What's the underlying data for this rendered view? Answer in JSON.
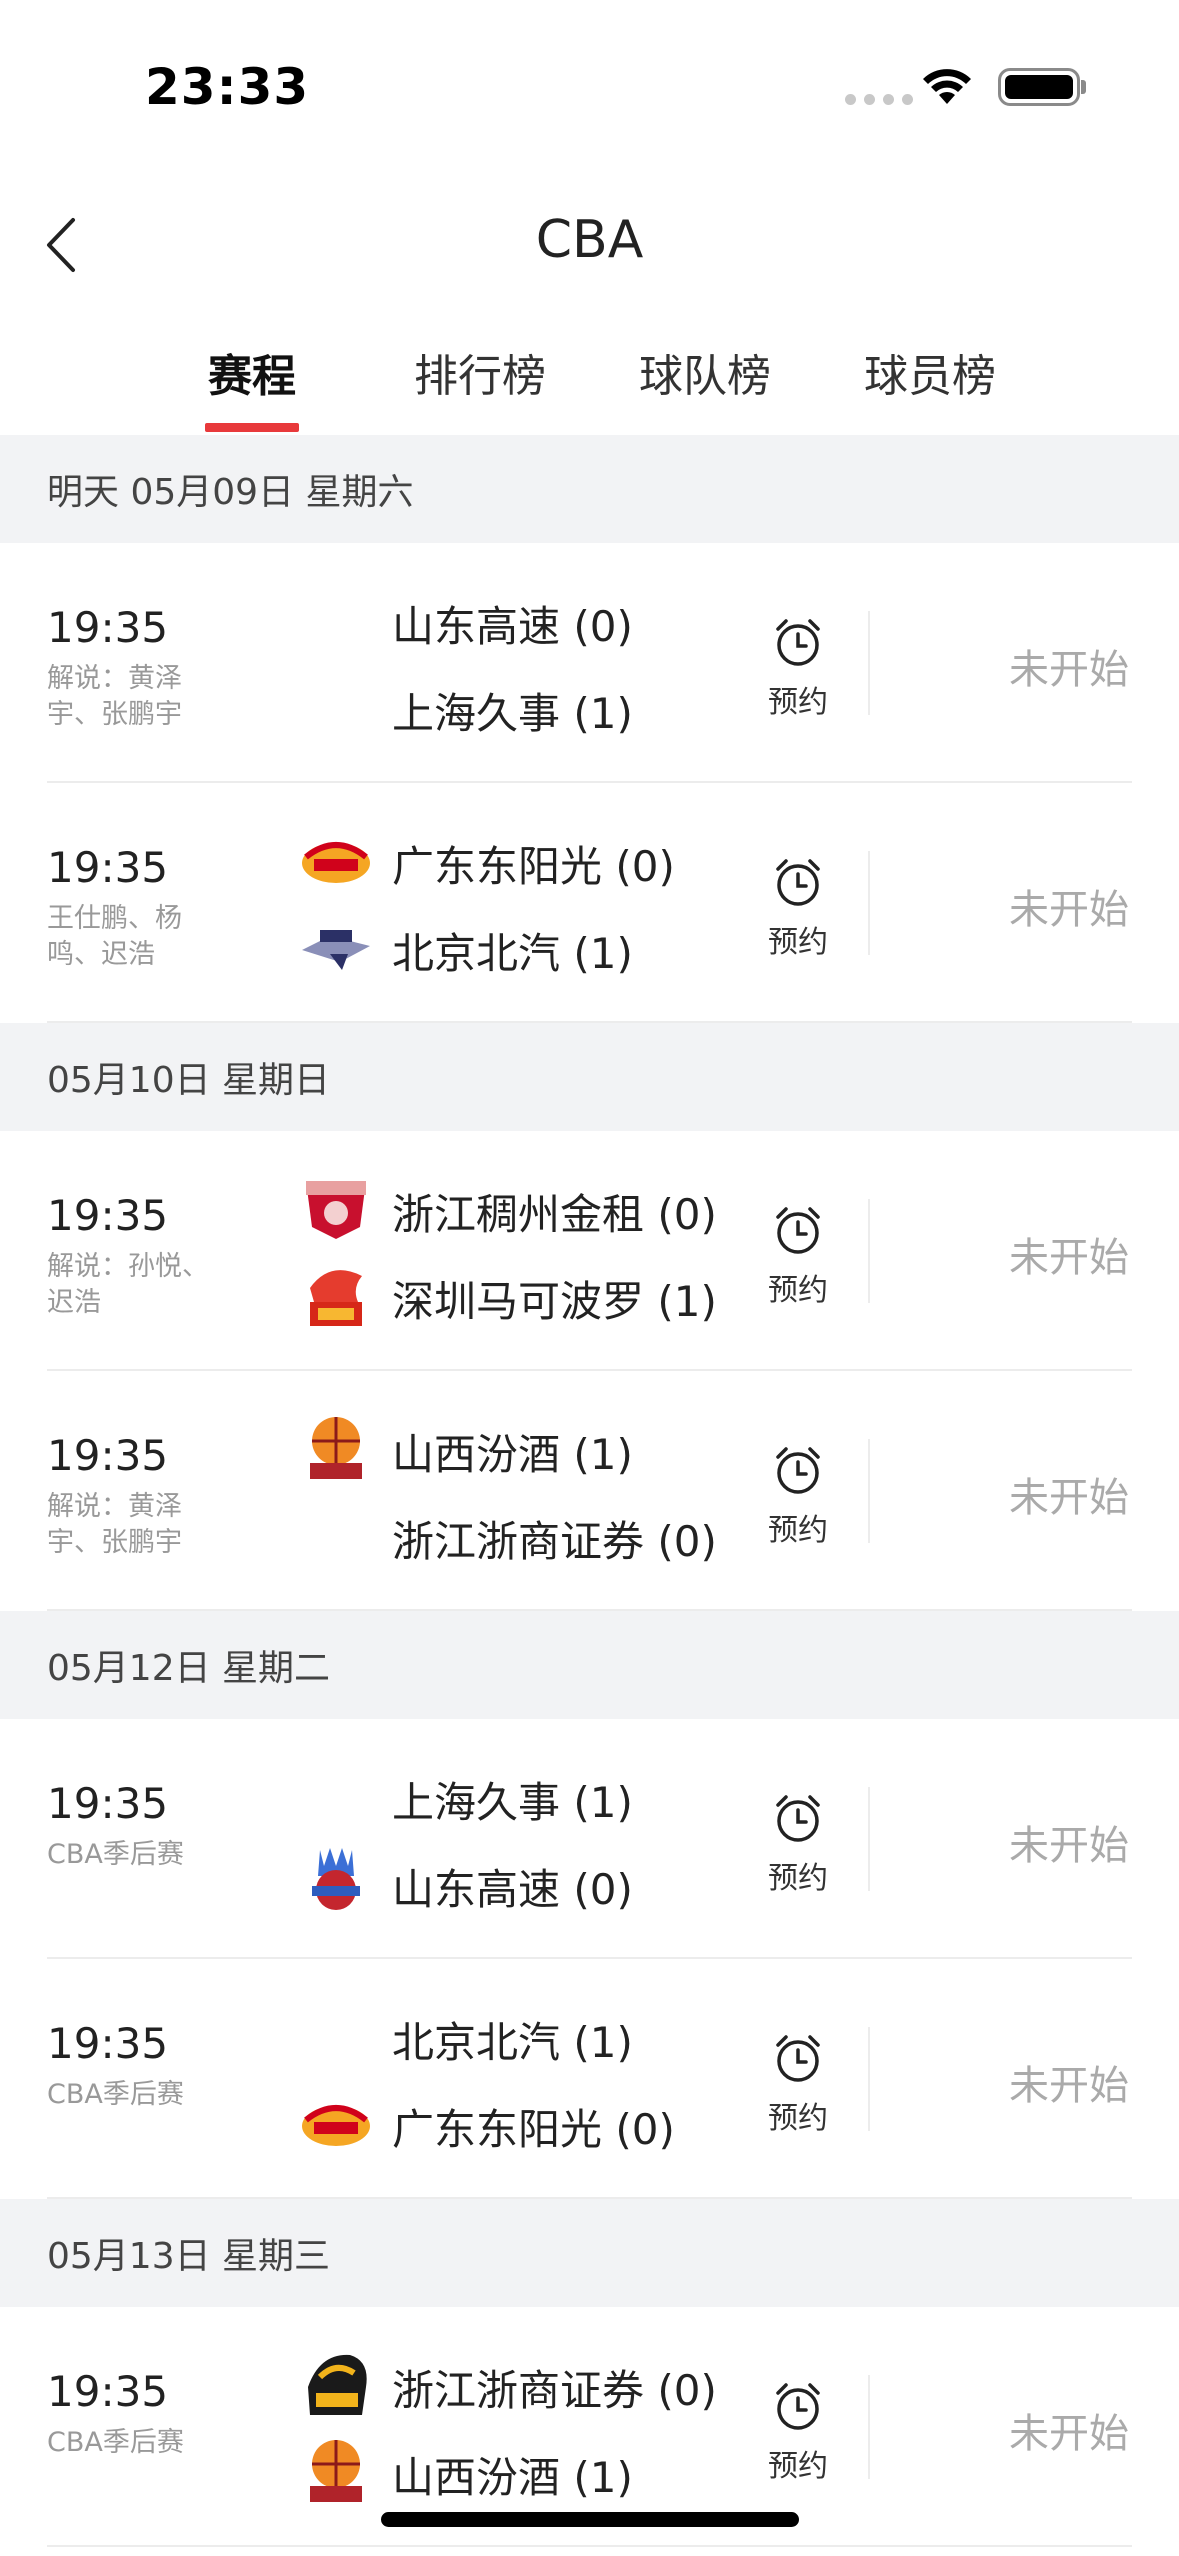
{
  "status_bar": {
    "time": "23:33"
  },
  "nav": {
    "title": "CBA"
  },
  "tabs": [
    {
      "label": "赛程",
      "active": true
    },
    {
      "label": "排行榜",
      "active": false
    },
    {
      "label": "球队榜",
      "active": false
    },
    {
      "label": "球员榜",
      "active": false
    }
  ],
  "colors": {
    "accent": "#e8393b",
    "date_header_bg": "#f2f3f5",
    "status_text": "#aaaaaa"
  },
  "remind_label": "预约",
  "schedule": [
    {
      "date": "明天 05月09日 星期六",
      "matches": [
        {
          "time": "19:35",
          "sub": "解说：黄泽宇、张鹏宇",
          "team1": "山东高速 (0)",
          "team1_logo": "",
          "team2": "上海久事 (1)",
          "team2_logo": "",
          "status": "未开始"
        },
        {
          "time": "19:35",
          "sub": "王仕鹏、杨鸣、迟浩",
          "team1": "广东东阳光 (0)",
          "team1_logo": "guangdong-logo",
          "team2": "北京北汽 (1)",
          "team2_logo": "beijing-logo",
          "status": "未开始"
        }
      ]
    },
    {
      "date": "05月10日 星期日",
      "matches": [
        {
          "time": "19:35",
          "sub": "解说：孙悦、迟浩",
          "team1": "浙江稠州金租 (0)",
          "team1_logo": "zhejiang-guangsha-logo",
          "team2": "深圳马可波罗 (1)",
          "team2_logo": "shenzhen-logo",
          "status": "未开始"
        },
        {
          "time": "19:35",
          "sub": "解说：黄泽宇、张鹏宇",
          "team1": "山西汾酒 (1)",
          "team1_logo": "shanxi-logo",
          "team2": "浙江浙商证券 (0)",
          "team2_logo": "",
          "status": "未开始"
        }
      ]
    },
    {
      "date": "05月12日 星期二",
      "matches": [
        {
          "time": "19:35",
          "sub": "CBA季后赛",
          "team1": "上海久事 (1)",
          "team1_logo": "",
          "team2": "山东高速 (0)",
          "team2_logo": "shandong-logo",
          "status": "未开始"
        },
        {
          "time": "19:35",
          "sub": "CBA季后赛",
          "team1": "北京北汽 (1)",
          "team1_logo": "",
          "team2": "广东东阳光 (0)",
          "team2_logo": "guangdong-logo",
          "status": "未开始"
        }
      ]
    },
    {
      "date": "05月13日 星期三",
      "matches": [
        {
          "time": "19:35",
          "sub": "CBA季后赛",
          "team1": "浙江浙商证券 (0)",
          "team1_logo": "zhejiang-logo",
          "team2": "山西汾酒 (1)",
          "team2_logo": "shanxi-logo",
          "status": "未开始"
        }
      ]
    }
  ]
}
